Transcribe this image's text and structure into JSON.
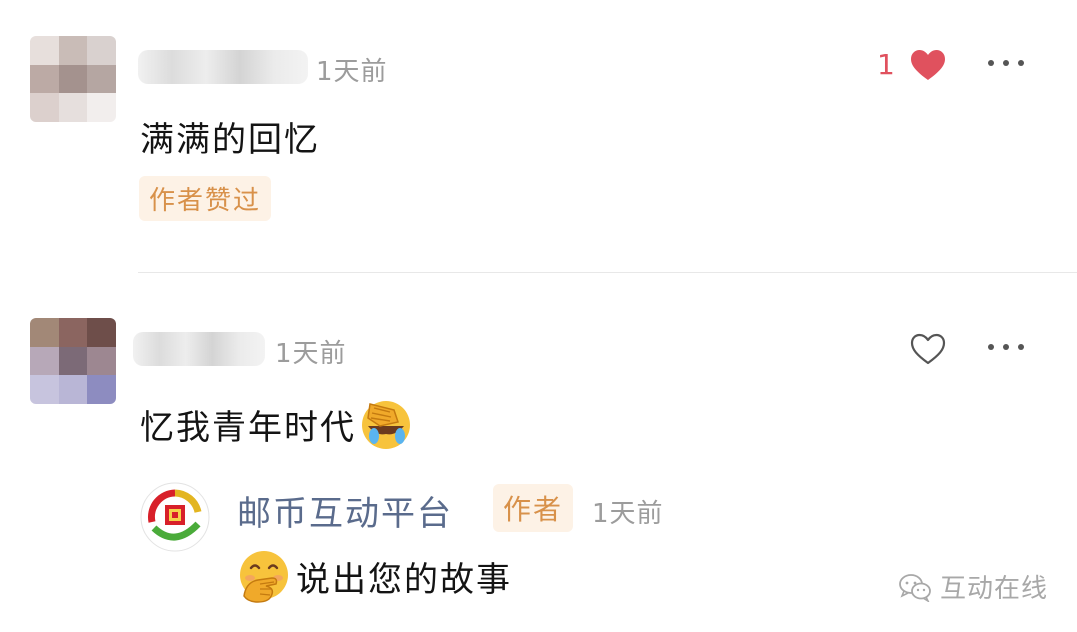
{
  "comments": [
    {
      "time": "1天前",
      "text": "满满的回忆",
      "liked_by_author_badge": "作者赞过",
      "like_count": "1",
      "liked": true,
      "more_icon": "more-horizontal-icon"
    },
    {
      "time": "1天前",
      "text": "忆我青年时代",
      "emoji": "facepalm-crying-emoji",
      "liked": false,
      "more_icon": "more-horizontal-icon",
      "reply": {
        "author": "邮币互动平台",
        "author_badge": "作者",
        "time": "1天前",
        "emoji": "hand-over-mouth-emoji",
        "text": "说出您的故事"
      }
    }
  ],
  "watermark": {
    "icon": "wechat-icon",
    "text": "互动在线"
  },
  "colors": {
    "heart_active": "#e0515e",
    "badge_bg": "#fdf2e6",
    "badge_text": "#d8914a",
    "reply_name": "#5a6b8c",
    "time_gray": "#9c9c9c"
  }
}
